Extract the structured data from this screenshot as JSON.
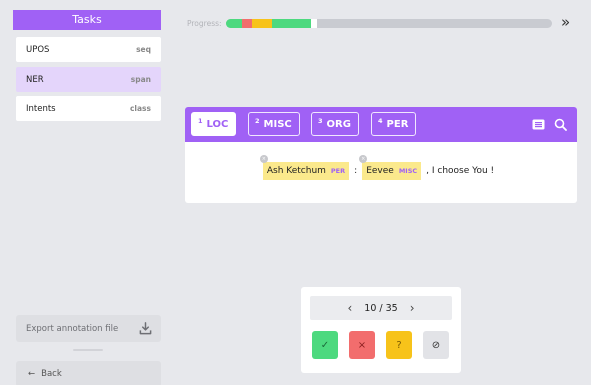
{
  "sidebar": {
    "title": "Tasks",
    "tasks": [
      {
        "name": "UPOS",
        "type": "seq"
      },
      {
        "name": "NER",
        "type": "span"
      },
      {
        "name": "Intents",
        "type": "class"
      }
    ],
    "export_label": "Export annotation file",
    "back_label": "Back"
  },
  "progress": {
    "label": "Progress:",
    "segments": [
      {
        "status": "accepted",
        "color": "#4dd97f",
        "fraction": 0.05
      },
      {
        "status": "rejected",
        "color": "#f26d6d",
        "fraction": 0.03
      },
      {
        "status": "skipped",
        "color": "#f7c31a",
        "fraction": 0.06
      },
      {
        "status": "accepted",
        "color": "#4dd97f",
        "fraction": 0.12
      },
      {
        "status": "current",
        "color": "#ffffff",
        "fraction": 0.02
      }
    ]
  },
  "labels": [
    {
      "key": "1",
      "name": "LOC",
      "selected": true
    },
    {
      "key": "2",
      "name": "MISC",
      "selected": false
    },
    {
      "key": "3",
      "name": "ORG",
      "selected": false
    },
    {
      "key": "4",
      "name": "PER",
      "selected": false
    }
  ],
  "sentence": {
    "entity1_text": "Ash Ketchum",
    "entity1_tag": "PER",
    "sep1": ":",
    "entity2_text": "Eevee",
    "entity2_tag": "MISC",
    "rest": ", I choose You !",
    "remove_glyph": "×"
  },
  "pager": {
    "prev": "‹",
    "position": "10 / 35",
    "next": "›"
  },
  "actions": {
    "accept": {
      "glyph": "✓",
      "color": "#4dd97f"
    },
    "reject": {
      "glyph": "×",
      "color": "#f26d6d"
    },
    "unsure": {
      "glyph": "?",
      "color": "#f7c31a"
    },
    "ignore": {
      "glyph": "⊘",
      "color": "#e2e3e7"
    }
  },
  "icons": {
    "expand": "»",
    "back_arrow": "←"
  },
  "colors": {
    "accent": "#a061f5",
    "entity_highlight": "#fbe98c",
    "active_task": "#e4d5fb"
  }
}
